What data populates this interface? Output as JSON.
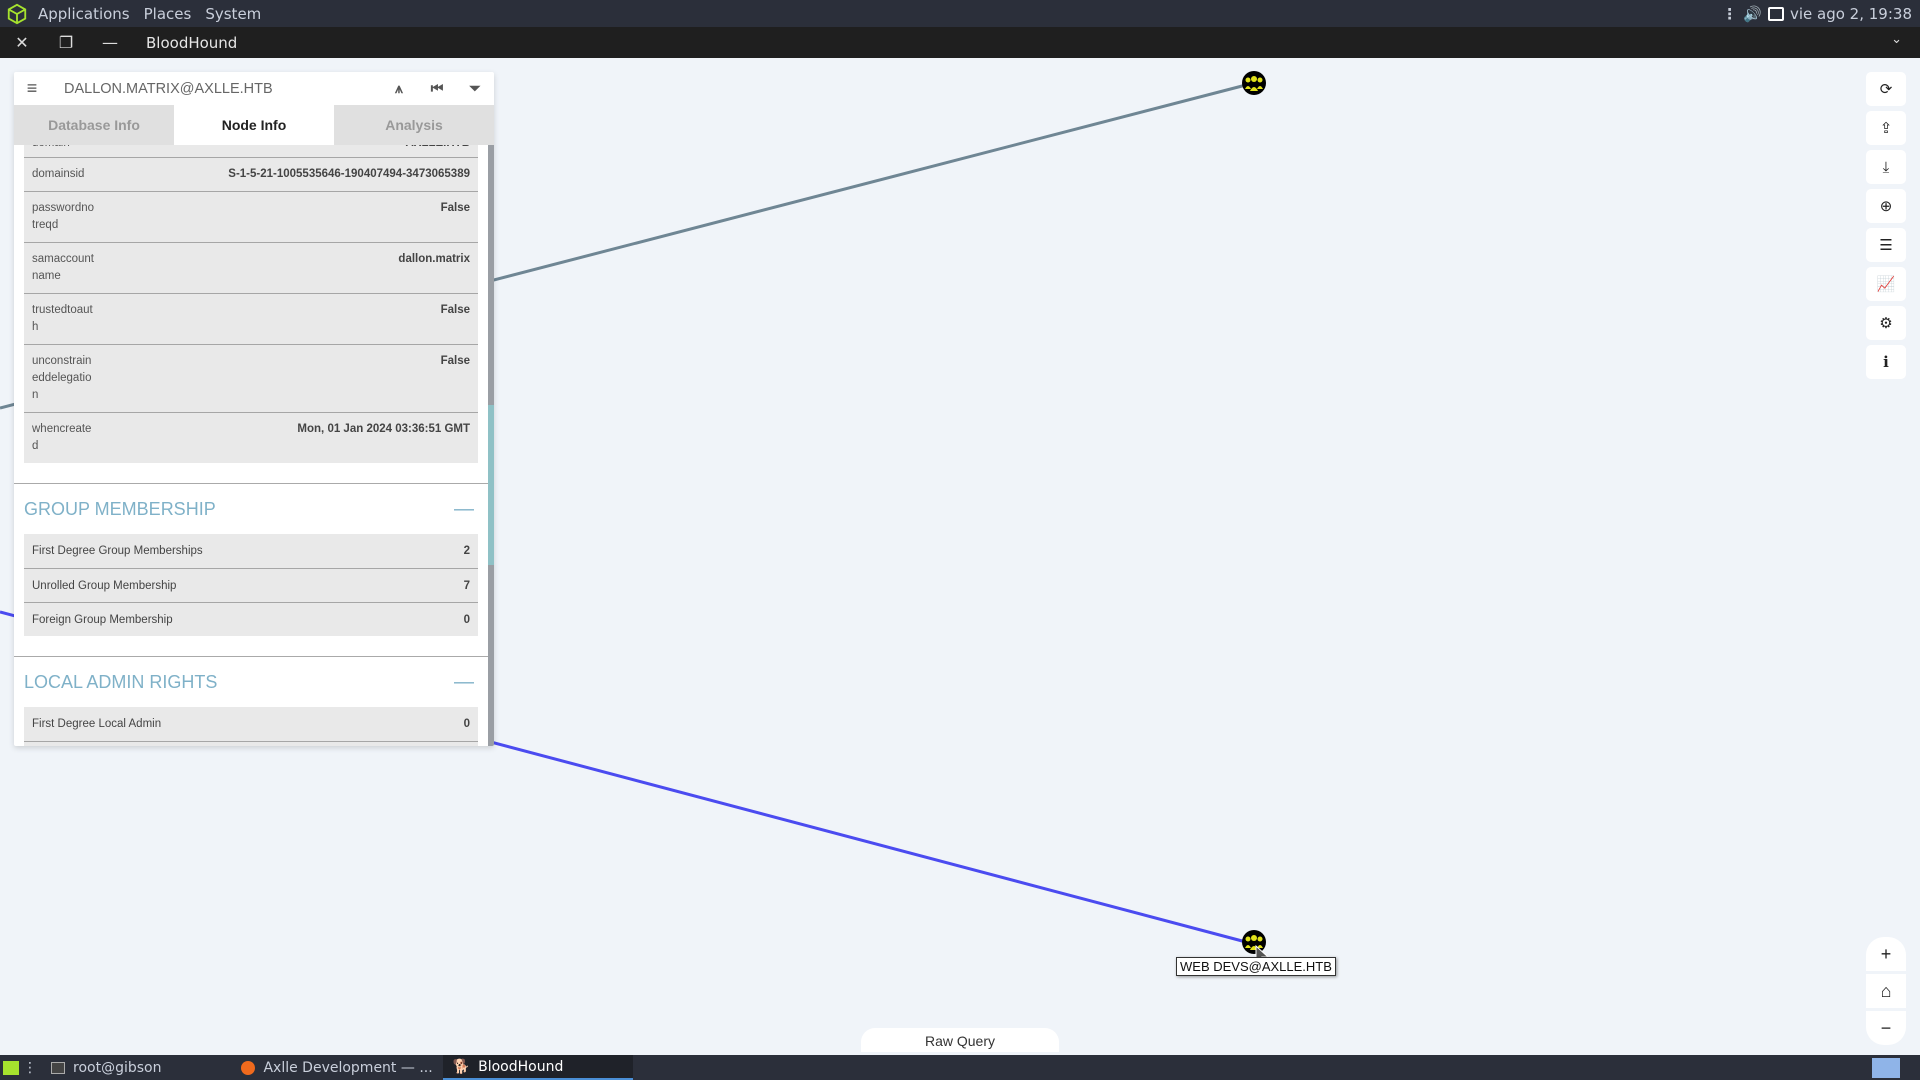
{
  "topbar": {
    "menus": [
      "Applications",
      "Places",
      "System"
    ],
    "clock": "vie ago 2, 19:38"
  },
  "window": {
    "title": "BloodHound"
  },
  "panel": {
    "node_name": "DALLON.MATRIX@AXLLE.HTB",
    "tabs": [
      {
        "label": "Database Info",
        "active": false
      },
      {
        "label": "Node Info",
        "active": true
      },
      {
        "label": "Analysis",
        "active": false
      }
    ],
    "properties": [
      {
        "key": "domain",
        "value": "AXLLE.HTB"
      },
      {
        "key": "domainsid",
        "value": "S-1-5-21-1005535646-190407494-3473065389"
      },
      {
        "key": "passwordnotreqd",
        "value": "False"
      },
      {
        "key": "samaccountname",
        "value": "dallon.matrix"
      },
      {
        "key": "trustedtoauth",
        "value": "False"
      },
      {
        "key": "unconstraineddelegation",
        "value": "False"
      },
      {
        "key": "whencreated",
        "value": "Mon, 01 Jan 2024 03:36:51 GMT"
      }
    ],
    "sections": [
      {
        "title": "GROUP MEMBERSHIP",
        "rows": [
          {
            "label": "First Degree Group Memberships",
            "value": "2"
          },
          {
            "label": "Unrolled Group Membership",
            "value": "7"
          },
          {
            "label": "Foreign Group Membership",
            "value": "0"
          }
        ]
      },
      {
        "title": "LOCAL ADMIN RIGHTS",
        "rows": [
          {
            "label": "First Degree Local Admin",
            "value": "0"
          }
        ]
      }
    ]
  },
  "graph": {
    "nodes": [
      {
        "name": "group-node-top",
        "label": ""
      },
      {
        "name": "group-node-web-devs",
        "label": "WEB DEVS@AXLLE.HTB"
      }
    ],
    "edge_colors": {
      "gray": "#6f8694",
      "blue": "#4b4bf0"
    },
    "node_color": "#e2e21a"
  },
  "right_toolbar": [
    "refresh-icon",
    "upload-icon",
    "download-icon",
    "circle-up-icon",
    "tasks-icon",
    "chart-icon",
    "cogs-icon",
    "info-icon"
  ],
  "zoom_controls": {
    "plus": "+",
    "home": "⌂",
    "minus": "−"
  },
  "raw_query": {
    "label": "Raw Query"
  },
  "taskbar": {
    "items": [
      {
        "label": "root@gibson",
        "active": false
      },
      {
        "label": "Axlle Development — ...",
        "active": false
      },
      {
        "label": "BloodHound",
        "active": true
      }
    ]
  }
}
